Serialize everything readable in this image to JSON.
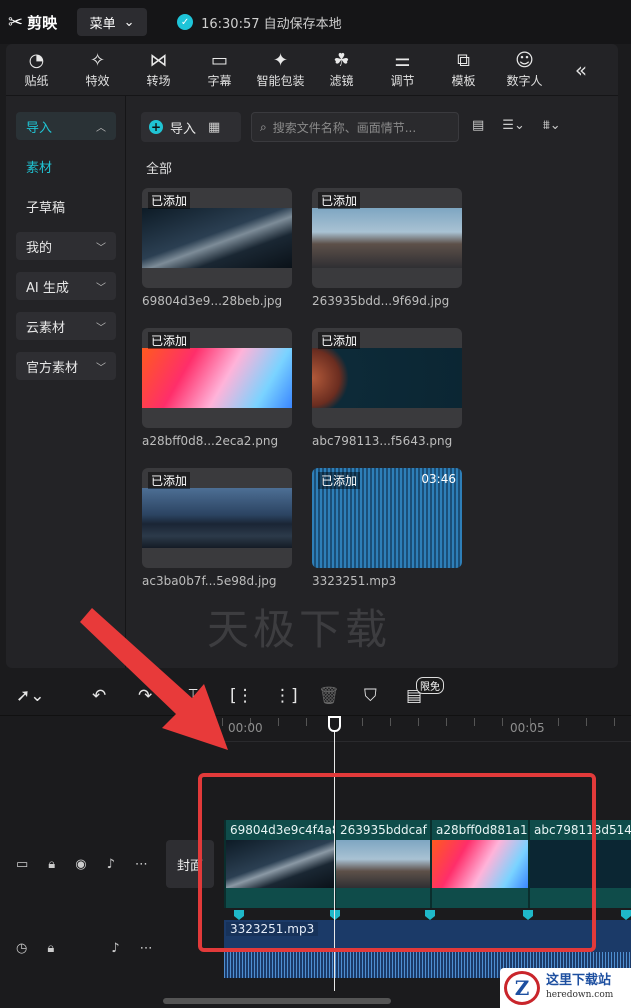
{
  "app": {
    "name": "剪映",
    "menu_label": "菜单",
    "autosave": "16:30:57 自动保存本地"
  },
  "toolbar": {
    "items": [
      {
        "label": "贴纸",
        "icon": "sticker-icon"
      },
      {
        "label": "特效",
        "icon": "effects-icon"
      },
      {
        "label": "转场",
        "icon": "transition-icon"
      },
      {
        "label": "字幕",
        "icon": "subtitle-icon"
      },
      {
        "label": "智能包装",
        "icon": "smart-pack-icon"
      },
      {
        "label": "滤镜",
        "icon": "filter-icon"
      },
      {
        "label": "调节",
        "icon": "adjust-icon"
      },
      {
        "label": "模板",
        "icon": "template-icon"
      },
      {
        "label": "数字人",
        "icon": "avatar-icon"
      }
    ]
  },
  "sidebar": {
    "items": [
      {
        "label": "导入",
        "chevron": "^"
      },
      {
        "label": "素材",
        "chevron": ""
      },
      {
        "label": "子草稿",
        "chevron": ""
      },
      {
        "label": "我的",
        "chevron": "v"
      },
      {
        "label": "AI 生成",
        "chevron": "v"
      },
      {
        "label": "云素材",
        "chevron": "v"
      },
      {
        "label": "官方素材",
        "chevron": "v"
      }
    ]
  },
  "media": {
    "import_label": "导入",
    "search_placeholder": "搜索文件名称、画面情节...",
    "section": "全部",
    "added_label": "已添加",
    "files": [
      {
        "name": "69804d3e9...28beb.jpg"
      },
      {
        "name": "263935bdd...9f69d.jpg"
      },
      {
        "name": "a28bff0d8...2eca2.png"
      },
      {
        "name": "abc798113...f5643.png"
      },
      {
        "name": "ac3ba0b7f...5e98d.jpg"
      },
      {
        "name": "3323251.mp3",
        "duration": "03:46"
      }
    ]
  },
  "watermark": "天极下载",
  "timeline": {
    "badge": "限免",
    "ruler": [
      "00:00",
      "00:05"
    ],
    "cover_label": "封面",
    "clips": [
      "69804d3e9c4f4a8",
      "263935bddcaf",
      "a28bff0d881a1",
      "abc798113d514"
    ],
    "audio_name": "3323251.mp3"
  },
  "site_logo": {
    "name": "这里下载站",
    "url": "heredown.com",
    "mark": "Z"
  },
  "colors": {
    "accent": "#20c4d4",
    "highlight": "#e23a3a",
    "video_track": "#0f4c4a",
    "audio_track": "#1b3a68"
  }
}
